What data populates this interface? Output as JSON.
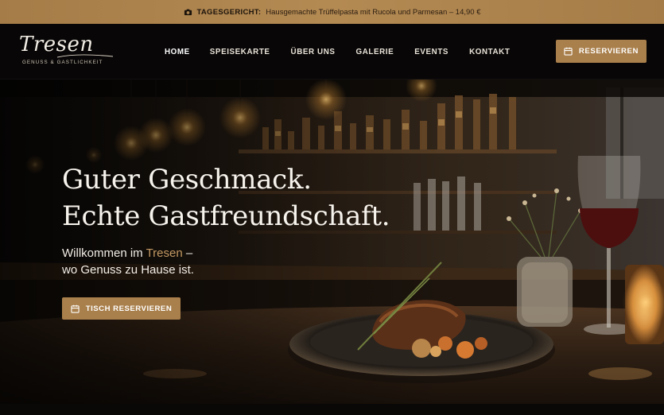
{
  "topbar": {
    "icon": "camera-icon",
    "label": "TAGESGERICHT:",
    "text": "Hausgemachte Trüffelpasta mit Rucola und Parmesan – 14,90 €"
  },
  "logo": {
    "word": "Tresen",
    "tagline": "Genuss & Gastlichkeit"
  },
  "nav": {
    "items": [
      {
        "label": "HOME",
        "active": true
      },
      {
        "label": "SPEISEKARTE",
        "active": false
      },
      {
        "label": "ÜBER UNS",
        "active": false
      },
      {
        "label": "GALERIE",
        "active": false
      },
      {
        "label": "EVENTS",
        "active": false
      },
      {
        "label": "KONTAKT",
        "active": false
      }
    ],
    "reserve_button": {
      "label": "RESERVIEREN",
      "icon": "calendar-icon"
    }
  },
  "hero": {
    "title_line1": "Guter Geschmack.",
    "title_line2": "Echte Gastfreundschaft.",
    "sub_prefix": "Willkommen im",
    "sub_brand": "Tresen",
    "sub_dash": "–",
    "sub_line2": "wo Genuss zu Hause ist.",
    "cta": {
      "label": "TISCH RESERVIEREN",
      "icon": "calendar-icon"
    }
  },
  "colors": {
    "accent": "#a97f4b",
    "brand_text": "#c49a63",
    "background": "#0d0b09"
  }
}
